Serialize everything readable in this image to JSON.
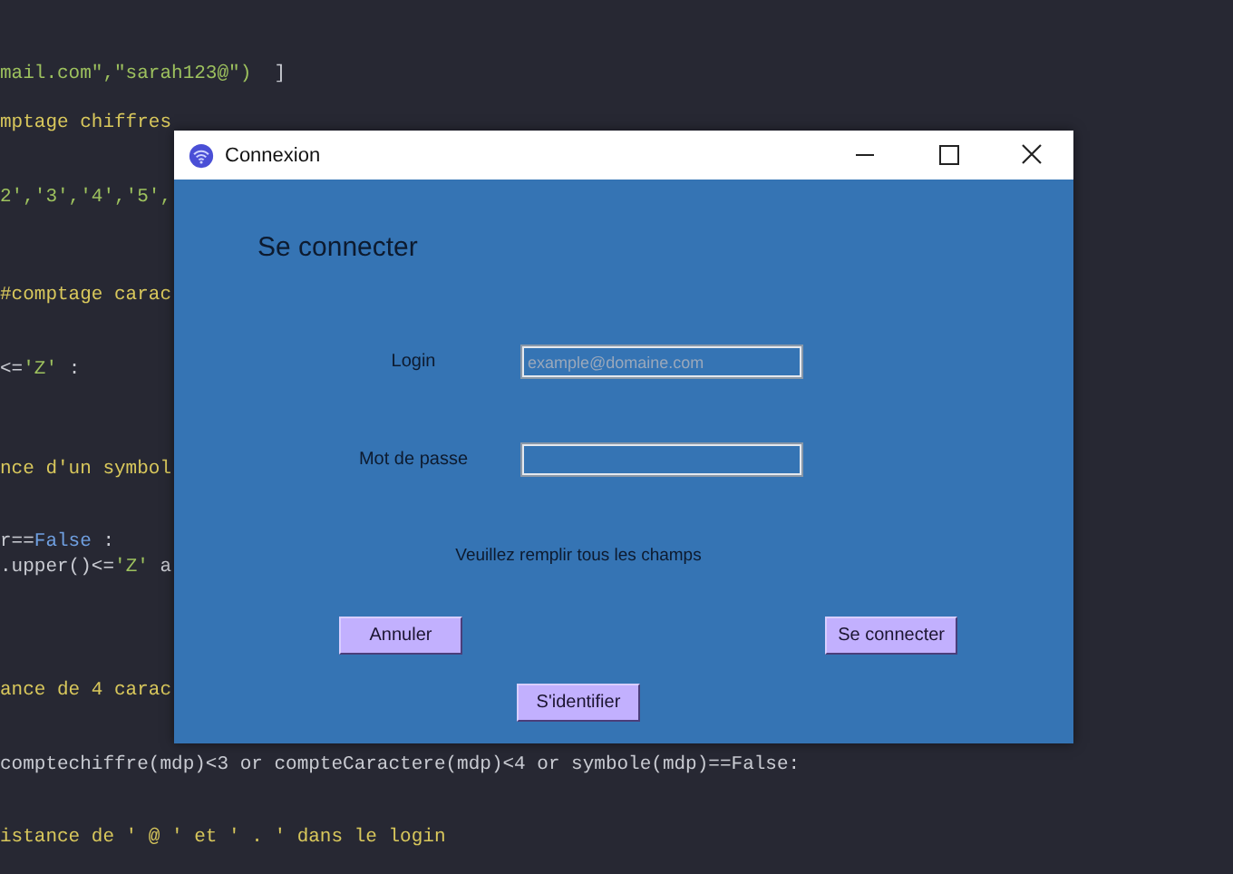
{
  "editor": {
    "lines": [
      {
        "segments": [
          {
            "text": "mail.com\",\"sarah123@\")",
            "kind": "string"
          },
          {
            "text": "  ]",
            "kind": "plain"
          }
        ]
      },
      {
        "segments": [
          {
            "text": "mptage chiffres",
            "kind": "comment"
          }
        ]
      },
      {
        "segments": [
          {
            "text": "2','3','4','5',",
            "kind": "string"
          }
        ]
      },
      {
        "segments": [
          {
            "text": "#comptage carac",
            "kind": "comment"
          }
        ]
      },
      {
        "segments": [
          {
            "text": "<=",
            "kind": "plain"
          },
          {
            "text": "'Z'",
            "kind": "string"
          },
          {
            "text": " :",
            "kind": "plain"
          }
        ]
      },
      {
        "segments": [
          {
            "text": "nce d'un symbol",
            "kind": "comment"
          }
        ]
      },
      {
        "segments": [
          {
            "text": "r==",
            "kind": "plain"
          },
          {
            "text": "False",
            "kind": "keyword"
          },
          {
            "text": " :",
            "kind": "plain"
          }
        ]
      },
      {
        "segments": [
          {
            "text": ".upper()<=",
            "kind": "plain"
          },
          {
            "text": "'Z'",
            "kind": "string"
          },
          {
            "text": " a",
            "kind": "plain"
          }
        ]
      },
      {
        "segments": [
          {
            "text": "ance de 4 carac",
            "kind": "comment"
          }
        ]
      },
      {
        "segments": [
          {
            "text": "comptechiffre(mdp)<3 or compteCaractere(mdp)<4 or symbole(mdp)==False:",
            "kind": "plain"
          }
        ]
      },
      {
        "segments": [
          {
            "text": "istance de ' @ ' et ' . ' dans le login",
            "kind": "comment"
          }
        ]
      }
    ]
  },
  "dialog": {
    "title": "Connexion",
    "heading": "Se connecter",
    "fields": [
      {
        "label": "Login",
        "placeholder": "example@domaine.com"
      },
      {
        "label": "Mot de passe"
      }
    ],
    "message": "Veuillez remplir tous les champs",
    "buttons": [
      {
        "label": "Annuler"
      },
      {
        "label": "Se connecter"
      },
      {
        "label": "S'identifier"
      }
    ]
  }
}
